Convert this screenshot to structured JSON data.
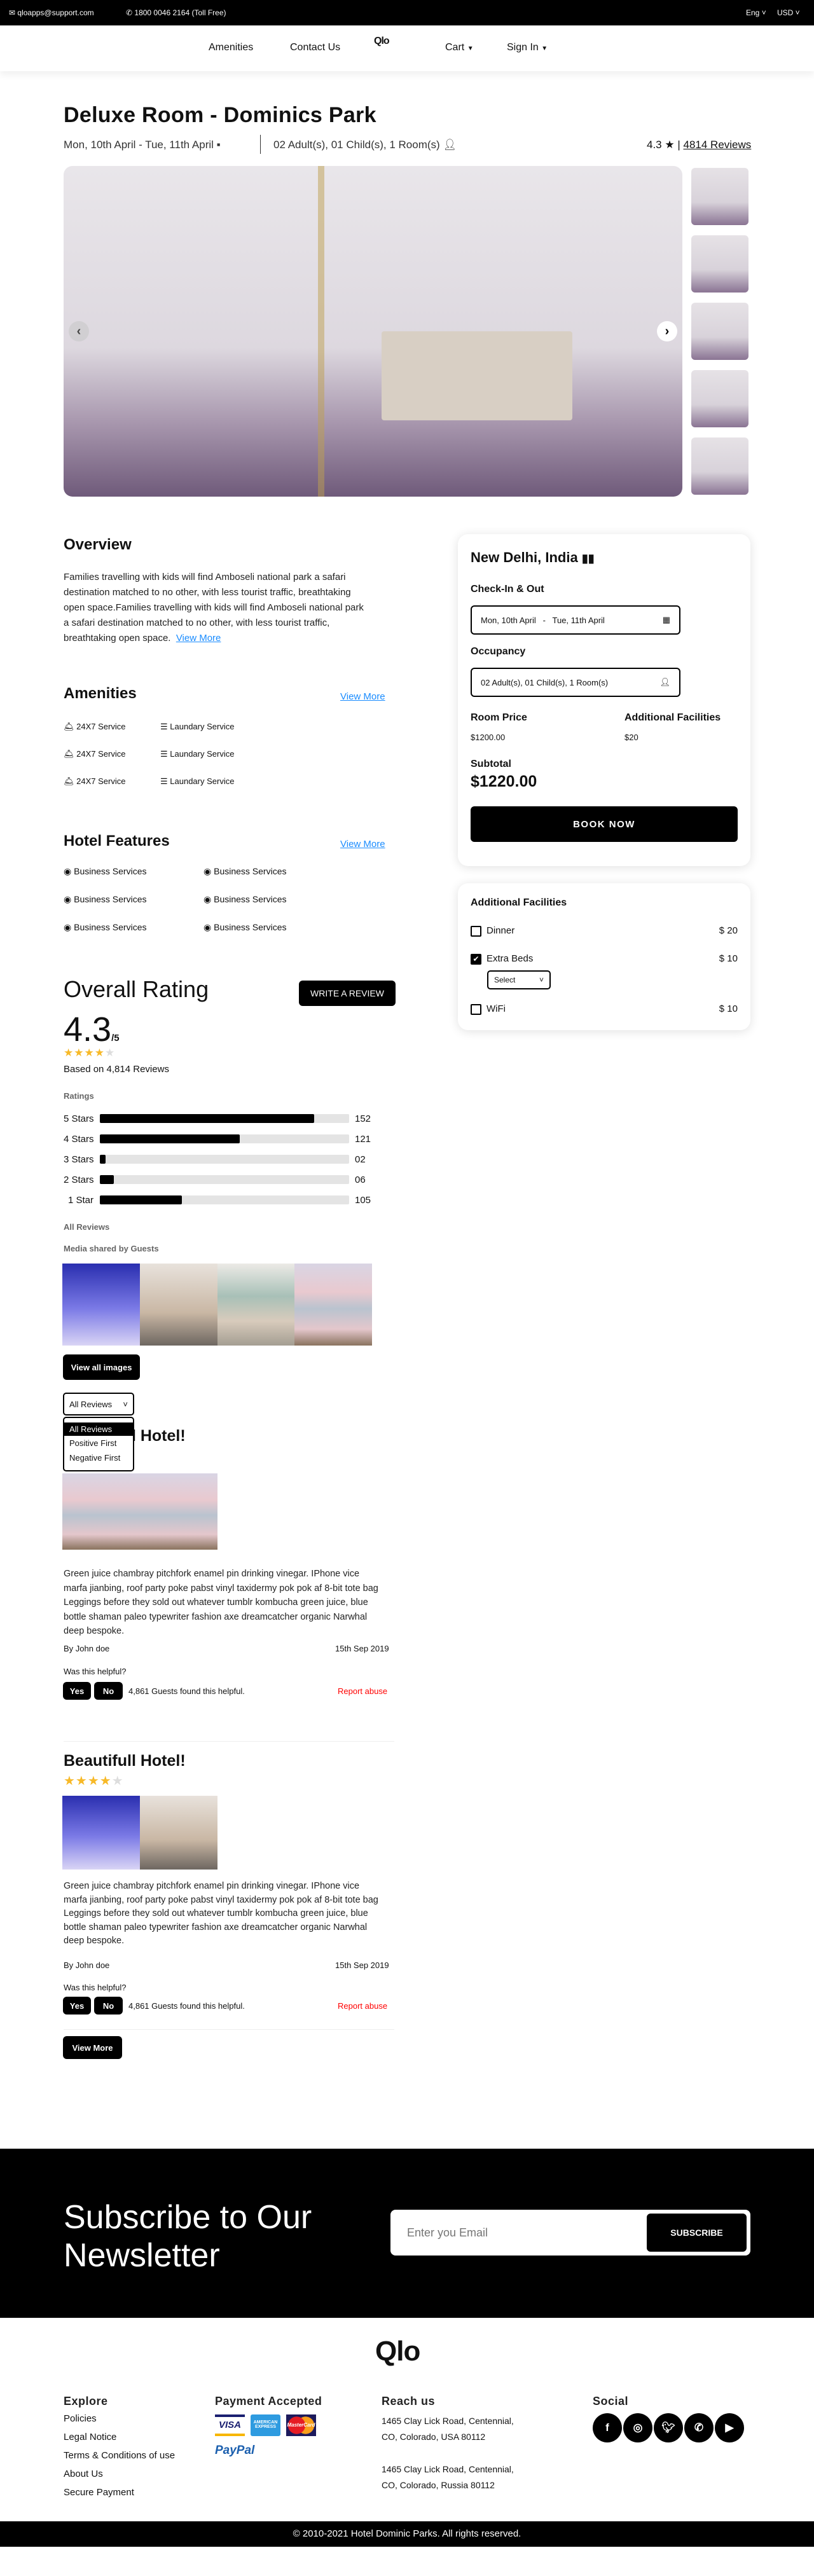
{
  "topbar": {
    "email": "qloapps@support.com",
    "phone": "1800 0046 2164 (Toll Free)",
    "language": "Eng",
    "currency": "USD"
  },
  "nav": {
    "amenities": "Amenities",
    "contact": "Contact Us",
    "logo": "Qlo",
    "cart": "Cart",
    "signin": "Sign In"
  },
  "room": {
    "title": "Deluxe Room - Dominics Park",
    "dates": "Mon, 10th April - Tue, 11th April",
    "occupancy": "02 Adult(s), 01 Child(s), 1 Room(s)",
    "rating": "4.3",
    "reviews_link": "4814 Reviews"
  },
  "overview": {
    "heading": "Overview",
    "text": "Families travelling with kids will find Amboseli national park a safari destination matched to no other, with less tourist traffic, breathtaking open space.Families travelling with kids will find Amboseli national park a safari destination matched to no other, with less tourist traffic, breathtaking open space.",
    "view_more": "View More"
  },
  "amenities": {
    "heading": "Amenities",
    "view_more": "View More",
    "items": [
      "24X7 Service",
      "Laundary Service",
      "24X7 Service",
      "Laundary Service",
      "24X7 Service",
      "Laundary Service"
    ]
  },
  "features": {
    "heading": "Hotel Features",
    "view_more": "View More",
    "items": [
      "Business Services",
      "Business Services",
      "Business Services",
      "Business Services",
      "Business Services",
      "Business Services"
    ]
  },
  "booking": {
    "location": "New Delhi, India",
    "checkin_label": "Check-In & Out",
    "checkin_from": "Mon, 10th April",
    "checkin_sep": "-",
    "checkin_to": "Tue, 11th April",
    "occupancy_label": "Occupancy",
    "occupancy_value": "02 Adult(s), 01 Child(s), 1 Room(s)",
    "room_price_label": "Room Price",
    "room_price": "$1200.00",
    "facilities_label": "Additional Facilities",
    "facilities_price": "$20",
    "subtotal_label": "Subtotal",
    "subtotal": "$1220.00",
    "book_now": "BOOK NOW"
  },
  "facilities": {
    "heading": "Additional Facilities",
    "items": [
      {
        "name": "Dinner",
        "price": "$ 20",
        "checked": false
      },
      {
        "name": "Extra Beds",
        "price": "$ 10",
        "checked": true,
        "select": "Select"
      },
      {
        "name": "WiFi",
        "price": "$ 10",
        "checked": false
      }
    ]
  },
  "rating": {
    "heading": "Overall Rating",
    "write_review": "WRITE A REVIEW",
    "score": "4.3",
    "out_of": "/5",
    "stars": 4,
    "based_on": "Based on 4,814 Reviews",
    "ratings_label": "Ratings",
    "bars": [
      {
        "label": "5 Stars",
        "count": "152",
        "fill": 0.86
      },
      {
        "label": "4 Stars",
        "count": "121",
        "fill": 0.56
      },
      {
        "label": "3 Stars",
        "count": "02",
        "fill": 0.024
      },
      {
        "label": "2 Stars",
        "count": "06",
        "fill": 0.057
      },
      {
        "label": "1 Star",
        "count": "105",
        "fill": 0.33
      }
    ],
    "all_reviews": "All Reviews",
    "media_label": "Media shared by Guests",
    "view_all_images": "View all images"
  },
  "sort": {
    "selected": "All Reviews",
    "options": [
      "All Reviews",
      "Positive First",
      "Negative First"
    ]
  },
  "reviews": [
    {
      "title": "Beautifull Hotel!",
      "stars": 4,
      "text": "Green juice chambray pitchfork enamel pin drinking vinegar. IPhone vice marfa jianbing, roof party poke pabst vinyl taxidermy pok pok af 8-bit tote bag Leggings before they sold out whatever tumblr kombucha green juice, blue bottle shaman paleo typewriter fashion axe dreamcatcher organic Narwhal deep bespoke.",
      "author": "By John doe",
      "date": "15th Sep 2019",
      "helpful_q": "Was this helpful?",
      "yes": "Yes",
      "no": "No",
      "helpful_count": "4,861 Guests found this helpful.",
      "report": "Report abuse"
    },
    {
      "title": "Beautifull Hotel!",
      "stars": 4,
      "text": "Green juice chambray pitchfork enamel pin drinking vinegar. IPhone vice marfa jianbing, roof party poke pabst vinyl taxidermy pok pok af 8-bit tote bag Leggings before they sold out whatever tumblr kombucha green juice, blue bottle shaman paleo typewriter fashion axe dreamcatcher organic Narwhal deep bespoke.",
      "author": "By John doe",
      "date": "15th Sep 2019",
      "helpful_q": "Was this helpful?",
      "yes": "Yes",
      "no": "No",
      "helpful_count": "4,861 Guests found this helpful.",
      "report": "Report abuse"
    }
  ],
  "review_view_more": "View More",
  "newsletter": {
    "heading": "Subscribe to Our Newsletter",
    "placeholder": "Enter you Email",
    "button": "SUBSCRIBE"
  },
  "footer": {
    "logo": "Qlo",
    "explore": {
      "heading": "Explore",
      "links": [
        "Policies",
        "Legal Notice",
        "Terms & Conditions of use",
        "About Us",
        "Secure Payment"
      ]
    },
    "payment": {
      "heading": "Payment Accepted",
      "methods": [
        "VISA",
        "AMERICAN EXPRESS",
        "MasterCard",
        "PayPal"
      ]
    },
    "reach": {
      "heading": "Reach us",
      "addresses": [
        "1465  Clay Lick Road, Centennial, CO, Colorado, USA 80112",
        "1465  Clay Lick Road, Centennial, CO, Colorado, Russia 80112"
      ]
    },
    "social": {
      "heading": "Social",
      "icons": [
        "facebook",
        "instagram",
        "twitter",
        "whatsapp",
        "youtube"
      ]
    },
    "copyright": "© 2010-2021  Hotel Dominic Parks.  All rights reserved."
  }
}
